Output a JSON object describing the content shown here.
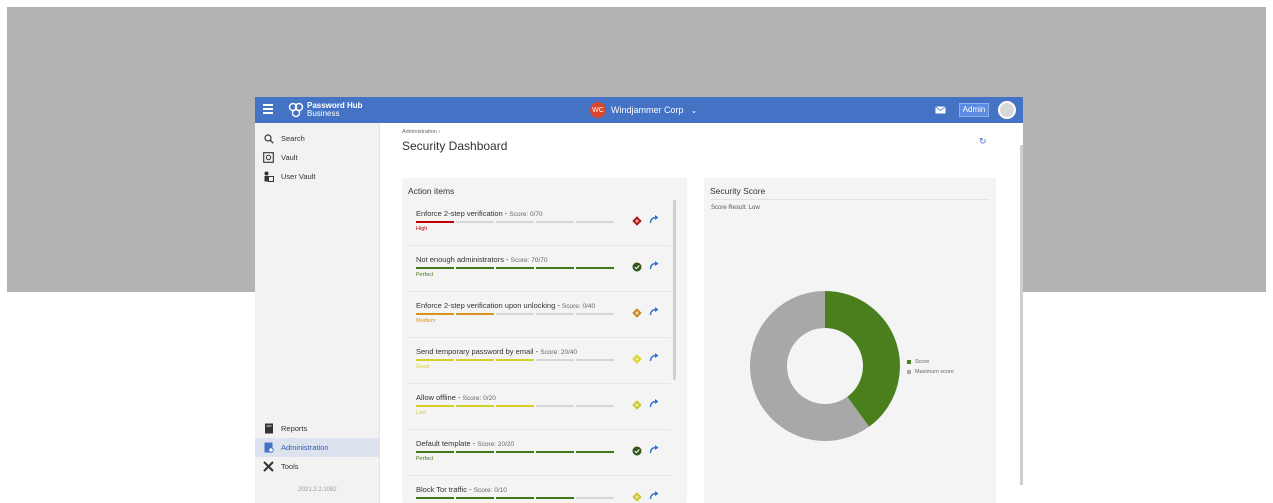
{
  "header": {
    "brand_line1": "Password Hub",
    "brand_line2": "Business",
    "company_badge": "WC",
    "company_name": "Windjammer Corp",
    "admin_label": "Admin",
    "colors": {
      "topbar": "#4472c4",
      "badge": "#d9462b"
    }
  },
  "sidebar": {
    "top_items": [
      {
        "label": "Search",
        "icon": "search-icon"
      },
      {
        "label": "Vault",
        "icon": "vault-icon"
      },
      {
        "label": "User Vault",
        "icon": "user-vault-icon"
      }
    ],
    "bottom_items": [
      {
        "label": "Reports",
        "icon": "reports-icon"
      },
      {
        "label": "Administration",
        "icon": "administration-icon",
        "active": true
      },
      {
        "label": "Tools",
        "icon": "tools-icon"
      }
    ],
    "version": "2021.2.2.1092"
  },
  "page": {
    "breadcrumb": "Administration ›",
    "title": "Security Dashboard"
  },
  "action_items": {
    "title": "Action items",
    "items": [
      {
        "name": "Enforce 2-step verification",
        "score": "Score: 0/70",
        "level": "High",
        "filled": 1,
        "total": 5,
        "color": "#c00000",
        "status": "high-risk-icon"
      },
      {
        "name": "Not enough administrators",
        "score": "Score: 70/70",
        "level": "Perfect",
        "filled": 5,
        "total": 5,
        "color": "#3f7a1a",
        "status": "check-icon"
      },
      {
        "name": "Enforce 2-step verification upon unlocking",
        "score": "Score: 0/40",
        "level": "Medium",
        "filled": 2,
        "total": 5,
        "color": "#d9931a",
        "status": "medium-risk-icon"
      },
      {
        "name": "Send temporary password by email",
        "score": "Score: 20/40",
        "level": "Good",
        "filled": 3,
        "total": 5,
        "color": "#d4d12a",
        "status": "good-risk-icon"
      },
      {
        "name": "Allow offline",
        "score": "Score: 0/20",
        "level": "Low",
        "filled": 3,
        "total": 5,
        "color": "#d4d12a",
        "status": "low-risk-icon"
      },
      {
        "name": "Default template",
        "score": "Score: 20/20",
        "level": "Perfect",
        "filled": 5,
        "total": 5,
        "color": "#3f7a1a",
        "status": "check-icon"
      },
      {
        "name": "Block Tor traffic",
        "score": "Score: 0/10",
        "level": "",
        "filled": 4,
        "total": 5,
        "color": "#3f7a1a",
        "status": "low-risk-icon"
      }
    ]
  },
  "security_score": {
    "title": "Security Score",
    "result": "Score Result: Low",
    "legend": [
      {
        "label": "Score",
        "color": "#4a7f1d"
      },
      {
        "label": "Maximum score",
        "color": "#a8a8a8"
      }
    ],
    "score_fraction": 0.4
  }
}
